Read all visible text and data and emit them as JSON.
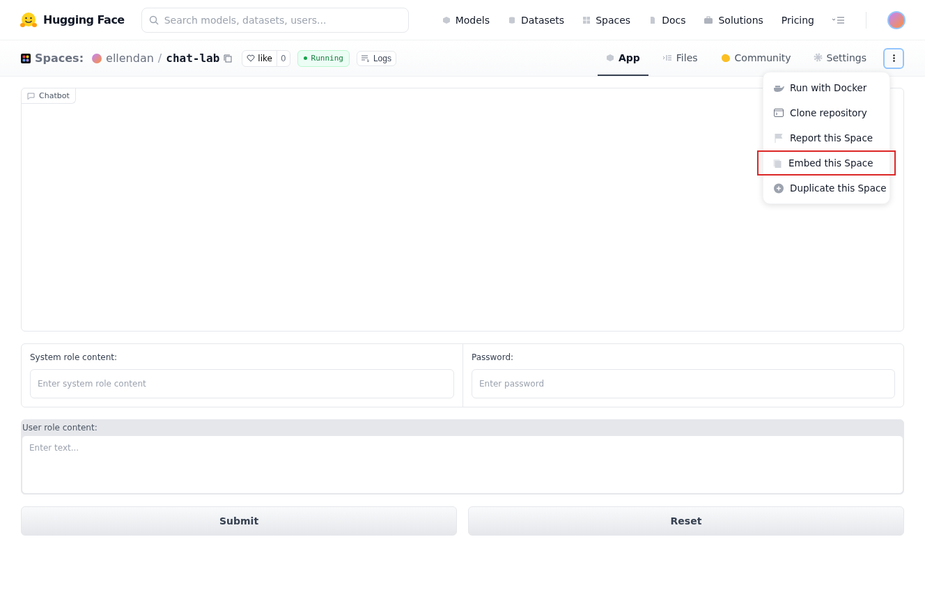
{
  "header": {
    "brand": "Hugging Face",
    "search": {
      "placeholder": "Search models, datasets, users..."
    },
    "nav": [
      {
        "label": "Models",
        "kind": "models"
      },
      {
        "label": "Datasets",
        "kind": "datasets"
      },
      {
        "label": "Spaces",
        "kind": "spaces"
      },
      {
        "label": "Docs",
        "kind": "docs"
      },
      {
        "label": "Solutions",
        "kind": "solutions"
      },
      {
        "label": "Pricing",
        "kind": "none"
      }
    ]
  },
  "space_bar": {
    "section": "Spaces:",
    "owner": "ellendan",
    "separator": "/",
    "name": "chat-lab",
    "like_label": "like",
    "like_count": "0",
    "status": "Running",
    "logs": "Logs",
    "tabs": [
      {
        "label": "App",
        "kind": "app",
        "selected": true
      },
      {
        "label": "Files",
        "kind": "files",
        "selected": false
      },
      {
        "label": "Community",
        "kind": "community",
        "selected": false
      },
      {
        "label": "Settings",
        "kind": "settings",
        "selected": false
      }
    ]
  },
  "menu": {
    "expanded": true,
    "items": [
      {
        "label": "Run with Docker",
        "kind": "docker",
        "highlighted": false
      },
      {
        "label": "Clone repository",
        "kind": "terminal",
        "highlighted": false
      },
      {
        "label": "Report this Space",
        "kind": "flag",
        "highlighted": false
      },
      {
        "label": "Embed this Space",
        "kind": "embed",
        "highlighted": true
      },
      {
        "label": "Duplicate this Space",
        "kind": "duplicate",
        "highlighted": false
      }
    ]
  },
  "chatbot": {
    "label": "Chatbot"
  },
  "fields": [
    {
      "label": "System role content:",
      "placeholder": "Enter system role content"
    },
    {
      "label": "Password:",
      "placeholder": "Enter password"
    }
  ],
  "user_field": {
    "label": "User role content:",
    "placeholder": "Enter text..."
  },
  "buttons": [
    "Submit",
    "Reset"
  ]
}
